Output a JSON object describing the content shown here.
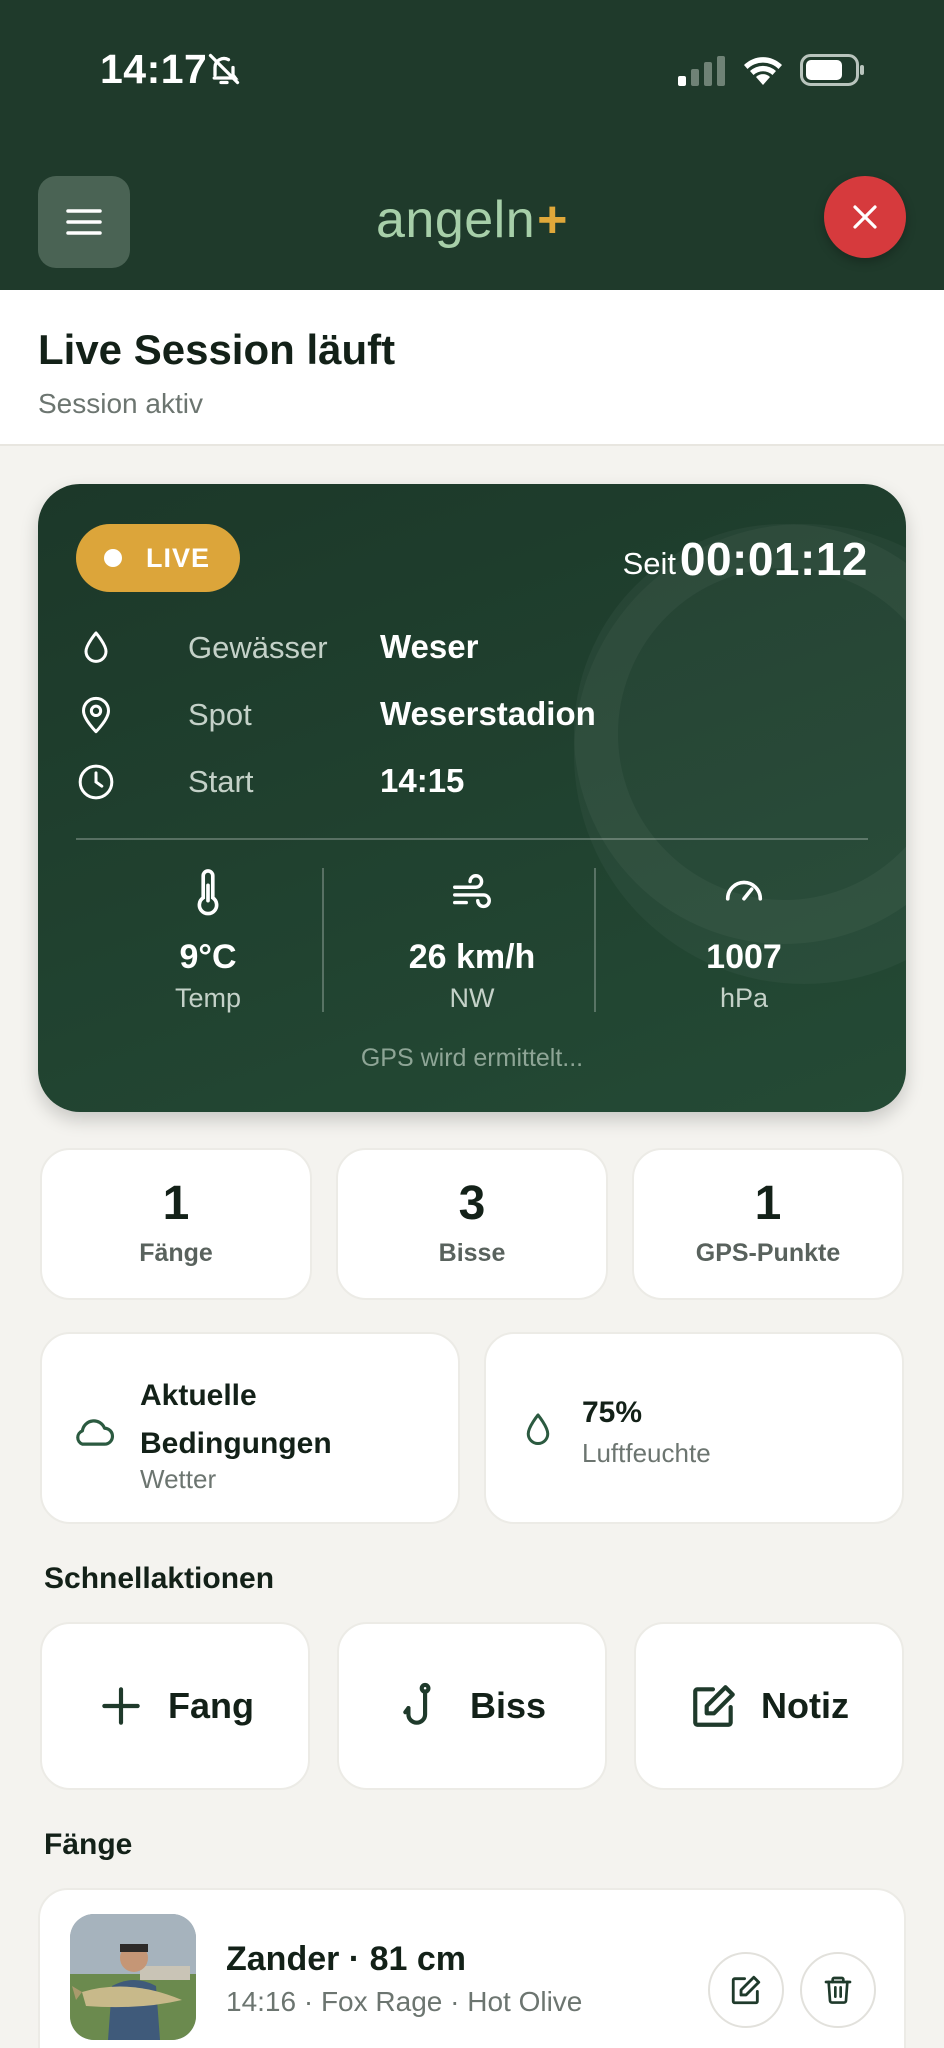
{
  "status_bar": {
    "time": "14:17"
  },
  "header": {
    "logo_text": "angeln",
    "logo_plus": "+"
  },
  "page": {
    "title": "Live Session läuft",
    "subtitle": "Session aktiv"
  },
  "live_card": {
    "badge": "LIVE",
    "since_label": "Seit",
    "elapsed": "00:01:12",
    "info": [
      {
        "icon": "water-drop-icon",
        "label": "Gewässer",
        "value": "Weser"
      },
      {
        "icon": "location-pin-icon",
        "label": "Spot",
        "value": "Weserstadion"
      },
      {
        "icon": "clock-icon",
        "label": "Start",
        "value": "14:15"
      }
    ],
    "weather": [
      {
        "icon": "thermometer-icon",
        "value": "9°C",
        "label": "Temp"
      },
      {
        "icon": "wind-icon",
        "value": "26 km/h",
        "label": "NW"
      },
      {
        "icon": "gauge-icon",
        "value": "1007",
        "label": "hPa"
      }
    ],
    "gps_status": "GPS wird ermittelt..."
  },
  "stats": [
    {
      "value": "1",
      "label": "Fänge"
    },
    {
      "value": "3",
      "label": "Bisse"
    },
    {
      "value": "1",
      "label": "GPS-Punkte"
    }
  ],
  "conditions": {
    "title": "Aktuelle Bedingungen",
    "subtitle": "Wetter",
    "humidity_value": "75%",
    "humidity_label": "Luftfeuchte"
  },
  "quick_actions": {
    "title": "Schnellaktionen",
    "items": [
      {
        "icon": "plus-icon",
        "label": "Fang"
      },
      {
        "icon": "hook-icon",
        "label": "Biss"
      },
      {
        "icon": "edit-note-icon",
        "label": "Notiz"
      }
    ]
  },
  "catches": {
    "title": "Fänge",
    "items": [
      {
        "title": "Zander · 81 cm",
        "meta": "14:16 · Fox Rage · Hot Olive"
      }
    ]
  },
  "colors": {
    "header_bg": "#1f3a2b",
    "accent": "#dca53a",
    "danger": "#d63a3d",
    "logo": "#a7cfa9"
  }
}
